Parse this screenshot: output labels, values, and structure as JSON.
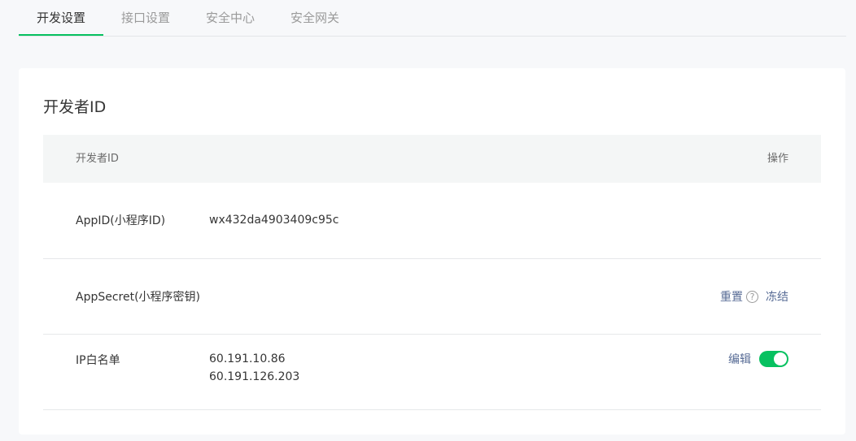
{
  "tabs": [
    {
      "label": "开发设置",
      "active": true
    },
    {
      "label": "接口设置",
      "active": false
    },
    {
      "label": "安全中心",
      "active": false
    },
    {
      "label": "安全网关",
      "active": false
    }
  ],
  "colors": {
    "accent": "#07c160",
    "link": "#576b95"
  },
  "card": {
    "title": "开发者ID",
    "header": {
      "col1": "开发者ID",
      "col2": "操作"
    },
    "rows": {
      "appid": {
        "label": "AppID(小程序ID)",
        "value": "wx432da4903409c95c"
      },
      "appsecret": {
        "label": "AppSecret(小程序密钥)",
        "reset_label": "重置",
        "help_glyph": "?",
        "freeze_label": "冻结"
      },
      "ip": {
        "label": "IP白名单",
        "ips": [
          "60.191.10.86",
          "60.191.126.203"
        ],
        "edit_label": "编辑",
        "toggle_on": true
      }
    }
  }
}
